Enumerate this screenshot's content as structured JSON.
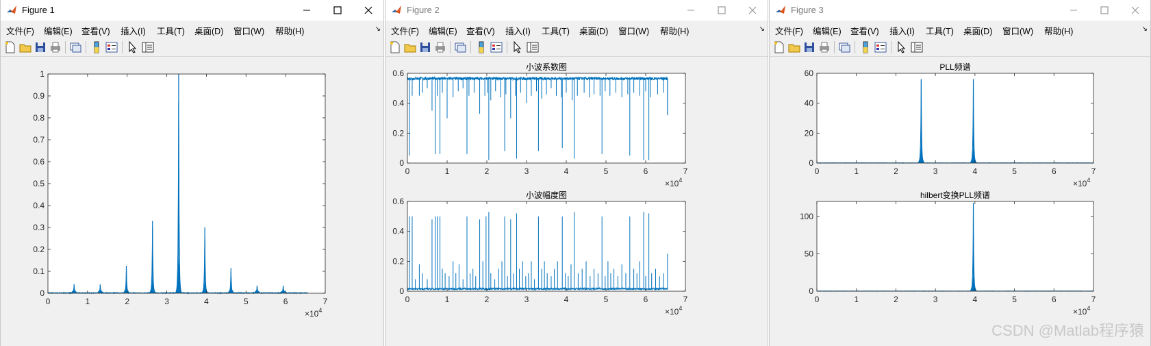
{
  "windows": [
    {
      "title": "Figure 1",
      "active": true
    },
    {
      "title": "Figure 2",
      "active": false
    },
    {
      "title": "Figure 3",
      "active": false
    }
  ],
  "menu": [
    "文件(F)",
    "编辑(E)",
    "查看(V)",
    "插入(I)",
    "工具(T)",
    "桌面(D)",
    "窗口(W)",
    "帮助(H)"
  ],
  "menu_overflow": "↘",
  "watermark": "CSDN @Matlab程序猿",
  "colors": {
    "line": "#0072BD",
    "axes": "#262626",
    "bg": "#f0f0f0"
  },
  "chart_data": [
    {
      "id": "fig1",
      "type": "line",
      "title": "",
      "xlabel": "",
      "ylabel": "",
      "xlim": [
        0,
        7
      ],
      "ylim": [
        0,
        1
      ],
      "x_ticks": [
        0,
        1,
        2,
        3,
        4,
        5,
        6,
        7
      ],
      "y_ticks": [
        0,
        0.1,
        0.2,
        0.3,
        0.4,
        0.5,
        0.6,
        0.7,
        0.8,
        0.9,
        1
      ],
      "x_tick_labels": [
        "0",
        "1",
        "2",
        "3",
        "4",
        "5",
        "6",
        "7"
      ],
      "y_tick_labels": [
        "0",
        "0.1",
        "0.2",
        "0.3",
        "0.4",
        "0.5",
        "0.6",
        "0.7",
        "0.8",
        "0.9",
        "1"
      ],
      "x_exponent": "×10^4",
      "grid": false,
      "end_x": 6.55,
      "peaks": [
        {
          "x": 0.66,
          "y": 0.04
        },
        {
          "x": 1.32,
          "y": 0.04
        },
        {
          "x": 1.98,
          "y": 0.125
        },
        {
          "x": 2.64,
          "y": 0.33
        },
        {
          "x": 3.3,
          "y": 1.0
        },
        {
          "x": 3.96,
          "y": 0.3
        },
        {
          "x": 4.62,
          "y": 0.115
        },
        {
          "x": 5.28,
          "y": 0.035
        },
        {
          "x": 5.94,
          "y": 0.035
        }
      ]
    },
    {
      "id": "fig2a",
      "type": "line",
      "title": "小波系数图",
      "xlabel": "",
      "ylabel": "",
      "xlim": [
        0,
        7
      ],
      "ylim": [
        0,
        0.6
      ],
      "x_ticks": [
        0,
        1,
        2,
        3,
        4,
        5,
        6,
        7
      ],
      "y_ticks": [
        0,
        0.2,
        0.4,
        0.6
      ],
      "x_tick_labels": [
        "0",
        "1",
        "2",
        "3",
        "4",
        "5",
        "6",
        "7"
      ],
      "y_tick_labels": [
        "0",
        "0.2",
        "0.4",
        "0.6"
      ],
      "x_exponent": "×10^4",
      "grid": false,
      "baseline": 0.565,
      "end_x": 6.55,
      "dips": [
        {
          "x": 0.05,
          "y": 0.05
        },
        {
          "x": 0.12,
          "y": 0.45
        },
        {
          "x": 0.3,
          "y": 0.45
        },
        {
          "x": 0.38,
          "y": 0.47
        },
        {
          "x": 0.5,
          "y": 0.5
        },
        {
          "x": 0.62,
          "y": 0.35
        },
        {
          "x": 0.75,
          "y": 0.45
        },
        {
          "x": 0.88,
          "y": 0.47
        },
        {
          "x": 1.0,
          "y": 0.3
        },
        {
          "x": 1.15,
          "y": 0.44
        },
        {
          "x": 1.28,
          "y": 0.48
        },
        {
          "x": 1.4,
          "y": 0.5
        },
        {
          "x": 1.55,
          "y": 0.45
        },
        {
          "x": 1.68,
          "y": 0.47
        },
        {
          "x": 1.82,
          "y": 0.33
        },
        {
          "x": 1.95,
          "y": 0.45
        },
        {
          "x": 2.02,
          "y": 0.47
        },
        {
          "x": 2.1,
          "y": 0.42
        },
        {
          "x": 2.22,
          "y": 0.48
        },
        {
          "x": 2.35,
          "y": 0.44
        },
        {
          "x": 2.48,
          "y": 0.46
        },
        {
          "x": 2.6,
          "y": 0.3
        },
        {
          "x": 2.72,
          "y": 0.45
        },
        {
          "x": 2.85,
          "y": 0.47
        },
        {
          "x": 3.0,
          "y": 0.4
        },
        {
          "x": 3.12,
          "y": 0.45
        },
        {
          "x": 3.25,
          "y": 0.48
        },
        {
          "x": 3.38,
          "y": 0.43
        },
        {
          "x": 3.5,
          "y": 0.46
        },
        {
          "x": 3.62,
          "y": 0.5
        },
        {
          "x": 3.75,
          "y": 0.45
        },
        {
          "x": 3.88,
          "y": 0.44
        },
        {
          "x": 4.0,
          "y": 0.47
        },
        {
          "x": 4.15,
          "y": 0.42
        },
        {
          "x": 4.28,
          "y": 0.45
        },
        {
          "x": 4.45,
          "y": 0.47
        },
        {
          "x": 4.58,
          "y": 0.44
        },
        {
          "x": 4.7,
          "y": 0.46
        },
        {
          "x": 4.85,
          "y": 0.45
        },
        {
          "x": 4.98,
          "y": 0.48
        },
        {
          "x": 5.1,
          "y": 0.45
        },
        {
          "x": 5.25,
          "y": 0.47
        },
        {
          "x": 5.4,
          "y": 0.44
        },
        {
          "x": 5.55,
          "y": 0.46
        },
        {
          "x": 5.7,
          "y": 0.47
        },
        {
          "x": 5.85,
          "y": 0.45
        },
        {
          "x": 6.0,
          "y": 0.48
        },
        {
          "x": 6.12,
          "y": 0.44
        },
        {
          "x": 6.3,
          "y": 0.46
        },
        {
          "x": 6.45,
          "y": 0.47
        },
        {
          "x": 0.7,
          "y": 0.06
        },
        {
          "x": 0.82,
          "y": 0.06
        },
        {
          "x": 1.5,
          "y": 0.06
        },
        {
          "x": 2.05,
          "y": 0.02
        },
        {
          "x": 2.45,
          "y": 0.08
        },
        {
          "x": 2.75,
          "y": 0.03
        },
        {
          "x": 3.3,
          "y": 0.08
        },
        {
          "x": 3.9,
          "y": 0.1
        },
        {
          "x": 4.2,
          "y": 0.03
        },
        {
          "x": 4.9,
          "y": 0.06
        },
        {
          "x": 5.6,
          "y": 0.05
        },
        {
          "x": 5.95,
          "y": 0.02
        },
        {
          "x": 6.08,
          "y": 0.02
        },
        {
          "x": 6.55,
          "y": 0.32
        }
      ]
    },
    {
      "id": "fig2b",
      "type": "line",
      "title": "小波幅度图",
      "xlabel": "",
      "ylabel": "",
      "xlim": [
        0,
        7
      ],
      "ylim": [
        0,
        0.6
      ],
      "x_ticks": [
        0,
        1,
        2,
        3,
        4,
        5,
        6,
        7
      ],
      "y_ticks": [
        0,
        0.2,
        0.4,
        0.6
      ],
      "x_tick_labels": [
        "0",
        "1",
        "2",
        "3",
        "4",
        "5",
        "6",
        "7"
      ],
      "y_tick_labels": [
        "0",
        "0.2",
        "0.4",
        "0.6"
      ],
      "x_exponent": "×10^4",
      "grid": false,
      "baseline": 0.01,
      "end_x": 6.55,
      "spikes": [
        {
          "x": 0.05,
          "y": 0.5
        },
        {
          "x": 0.12,
          "y": 0.5
        },
        {
          "x": 0.2,
          "y": 0.08
        },
        {
          "x": 0.3,
          "y": 0.18
        },
        {
          "x": 0.38,
          "y": 0.12
        },
        {
          "x": 0.5,
          "y": 0.08
        },
        {
          "x": 0.62,
          "y": 0.48
        },
        {
          "x": 0.7,
          "y": 0.5
        },
        {
          "x": 0.75,
          "y": 0.5
        },
        {
          "x": 0.82,
          "y": 0.5
        },
        {
          "x": 0.88,
          "y": 0.15
        },
        {
          "x": 0.95,
          "y": 0.12
        },
        {
          "x": 1.05,
          "y": 0.1
        },
        {
          "x": 1.15,
          "y": 0.2
        },
        {
          "x": 1.22,
          "y": 0.12
        },
        {
          "x": 1.3,
          "y": 0.18
        },
        {
          "x": 1.4,
          "y": 0.08
        },
        {
          "x": 1.5,
          "y": 0.5
        },
        {
          "x": 1.58,
          "y": 0.12
        },
        {
          "x": 1.65,
          "y": 0.15
        },
        {
          "x": 1.72,
          "y": 0.1
        },
        {
          "x": 1.82,
          "y": 0.48
        },
        {
          "x": 1.9,
          "y": 0.2
        },
        {
          "x": 1.98,
          "y": 0.5
        },
        {
          "x": 2.05,
          "y": 0.53
        },
        {
          "x": 2.1,
          "y": 0.12
        },
        {
          "x": 2.2,
          "y": 0.08
        },
        {
          "x": 2.3,
          "y": 0.15
        },
        {
          "x": 2.38,
          "y": 0.2
        },
        {
          "x": 2.45,
          "y": 0.5
        },
        {
          "x": 2.52,
          "y": 0.1
        },
        {
          "x": 2.6,
          "y": 0.48
        },
        {
          "x": 2.67,
          "y": 0.12
        },
        {
          "x": 2.75,
          "y": 0.52
        },
        {
          "x": 2.82,
          "y": 0.15
        },
        {
          "x": 2.9,
          "y": 0.2
        },
        {
          "x": 2.98,
          "y": 0.1
        },
        {
          "x": 3.05,
          "y": 0.12
        },
        {
          "x": 3.12,
          "y": 0.2
        },
        {
          "x": 3.2,
          "y": 0.08
        },
        {
          "x": 3.3,
          "y": 0.5
        },
        {
          "x": 3.38,
          "y": 0.15
        },
        {
          "x": 3.45,
          "y": 0.2
        },
        {
          "x": 3.52,
          "y": 0.12
        },
        {
          "x": 3.62,
          "y": 0.1
        },
        {
          "x": 3.7,
          "y": 0.15
        },
        {
          "x": 3.78,
          "y": 0.2
        },
        {
          "x": 3.9,
          "y": 0.5
        },
        {
          "x": 3.98,
          "y": 0.12
        },
        {
          "x": 4.05,
          "y": 0.1
        },
        {
          "x": 4.12,
          "y": 0.18
        },
        {
          "x": 4.2,
          "y": 0.53
        },
        {
          "x": 4.3,
          "y": 0.12
        },
        {
          "x": 4.4,
          "y": 0.15
        },
        {
          "x": 4.5,
          "y": 0.2
        },
        {
          "x": 4.6,
          "y": 0.1
        },
        {
          "x": 4.7,
          "y": 0.15
        },
        {
          "x": 4.8,
          "y": 0.12
        },
        {
          "x": 4.9,
          "y": 0.5
        },
        {
          "x": 4.98,
          "y": 0.1
        },
        {
          "x": 5.05,
          "y": 0.2
        },
        {
          "x": 5.12,
          "y": 0.12
        },
        {
          "x": 5.2,
          "y": 0.15
        },
        {
          "x": 5.3,
          "y": 0.1
        },
        {
          "x": 5.4,
          "y": 0.18
        },
        {
          "x": 5.5,
          "y": 0.12
        },
        {
          "x": 5.6,
          "y": 0.5
        },
        {
          "x": 5.7,
          "y": 0.15
        },
        {
          "x": 5.78,
          "y": 0.12
        },
        {
          "x": 5.85,
          "y": 0.2
        },
        {
          "x": 5.95,
          "y": 0.53
        },
        {
          "x": 6.0,
          "y": 0.1
        },
        {
          "x": 6.08,
          "y": 0.52
        },
        {
          "x": 6.15,
          "y": 0.12
        },
        {
          "x": 6.25,
          "y": 0.15
        },
        {
          "x": 6.35,
          "y": 0.1
        },
        {
          "x": 6.45,
          "y": 0.12
        },
        {
          "x": 6.55,
          "y": 0.25
        }
      ]
    },
    {
      "id": "fig3a",
      "type": "line",
      "title": "PLL频谱",
      "xlabel": "",
      "ylabel": "",
      "xlim": [
        0,
        7
      ],
      "ylim": [
        0,
        60
      ],
      "x_ticks": [
        0,
        1,
        2,
        3,
        4,
        5,
        6,
        7
      ],
      "y_ticks": [
        0,
        20,
        40,
        60
      ],
      "x_tick_labels": [
        "0",
        "1",
        "2",
        "3",
        "4",
        "5",
        "6",
        "7"
      ],
      "y_tick_labels": [
        "0",
        "20",
        "40",
        "60"
      ],
      "x_exponent": "×10^4",
      "grid": false,
      "end_x": 7,
      "peaks": [
        {
          "x": 2.64,
          "y": 56
        },
        {
          "x": 3.96,
          "y": 56
        }
      ]
    },
    {
      "id": "fig3b",
      "type": "line",
      "title": "hilbert变换PLL频谱",
      "xlabel": "",
      "ylabel": "",
      "xlim": [
        0,
        7
      ],
      "ylim": [
        0,
        120
      ],
      "x_ticks": [
        0,
        1,
        2,
        3,
        4,
        5,
        6,
        7
      ],
      "y_ticks": [
        0,
        50,
        100
      ],
      "x_tick_labels": [
        "0",
        "1",
        "2",
        "3",
        "4",
        "5",
        "6",
        "7"
      ],
      "y_tick_labels": [
        "0",
        "50",
        "100"
      ],
      "x_exponent": "×10^4",
      "grid": false,
      "end_x": 7,
      "peaks": [
        {
          "x": 3.96,
          "y": 118
        }
      ]
    }
  ]
}
